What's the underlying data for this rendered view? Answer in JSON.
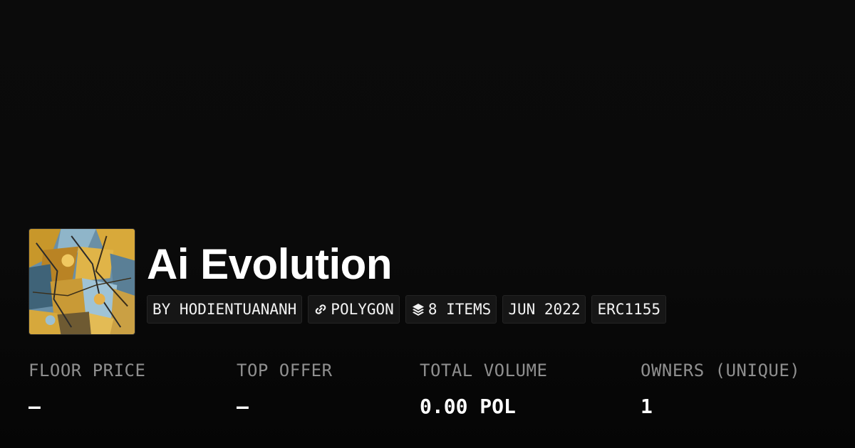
{
  "collection": {
    "name": "Ai Evolution",
    "image_alt": "Ai Evolution collection artwork"
  },
  "tags": [
    {
      "label": "BY HODIENTUANANH",
      "icon": ""
    },
    {
      "label": "POLYGON",
      "icon": "link-icon"
    },
    {
      "label": "8 ITEMS",
      "icon": "layers-icon"
    },
    {
      "label": "JUN 2022",
      "icon": ""
    },
    {
      "label": "ERC1155",
      "icon": ""
    }
  ],
  "stats": [
    {
      "label": "FLOOR PRICE",
      "value": "–"
    },
    {
      "label": "TOP OFFER",
      "value": "–"
    },
    {
      "label": "TOTAL VOLUME",
      "value": "0.00 POL"
    },
    {
      "label": "OWNERS (UNIQUE)",
      "value": "1"
    }
  ],
  "colors": {
    "background": "#0a0a0a",
    "tag_background": "#161616",
    "label_gray": "#8f8f8f",
    "text": "#ffffff"
  }
}
